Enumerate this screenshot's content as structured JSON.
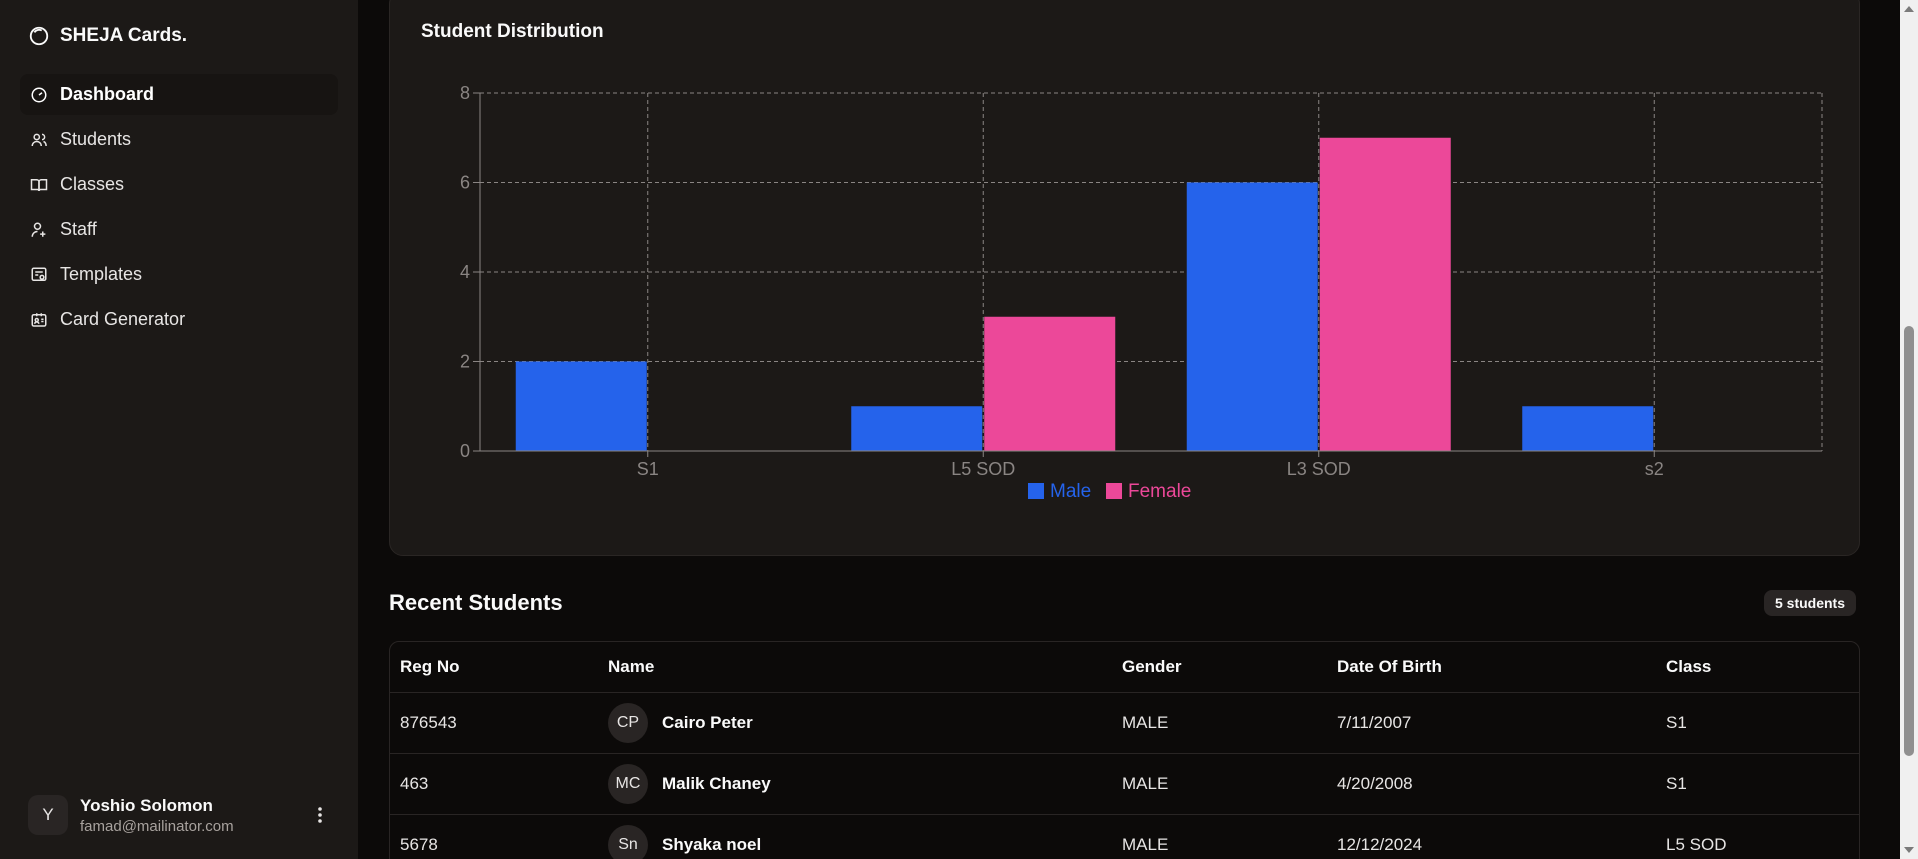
{
  "brand": {
    "name": "SHEJA Cards.",
    "icon": "circle-logo-icon"
  },
  "sidebar": {
    "items": [
      {
        "label": "Dashboard",
        "icon": "gauge-icon",
        "active": true
      },
      {
        "label": "Students",
        "icon": "users-icon",
        "active": false
      },
      {
        "label": "Classes",
        "icon": "book-open-icon",
        "active": false
      },
      {
        "label": "Staff",
        "icon": "user-plus-icon",
        "active": false
      },
      {
        "label": "Templates",
        "icon": "template-icon",
        "active": false
      },
      {
        "label": "Card Generator",
        "icon": "id-card-icon",
        "active": false
      }
    ]
  },
  "user": {
    "initial": "Y",
    "name": "Yoshio Solomon",
    "email": "famad@mailinator.com"
  },
  "distribution": {
    "title": "Student Distribution"
  },
  "chart_data": {
    "type": "bar",
    "title": "Student Distribution",
    "categories": [
      "S1",
      "L5 SOD",
      "L3 SOD",
      "s2"
    ],
    "series": [
      {
        "name": "Male",
        "values": [
          2,
          1,
          6,
          1
        ],
        "color": "#2563eb"
      },
      {
        "name": "Female",
        "values": [
          0,
          3,
          7,
          0
        ],
        "color": "#ec4899"
      }
    ],
    "ylim": [
      0,
      8
    ],
    "yticks": [
      0,
      2,
      4,
      6,
      8
    ],
    "grid": true,
    "legend": "bottom"
  },
  "recent": {
    "title": "Recent Students",
    "badge": "5 students",
    "columns": [
      "Reg No",
      "Name",
      "Gender",
      "Date Of Birth",
      "Class"
    ],
    "rows": [
      {
        "reg": "876543",
        "initials": "CP",
        "name": "Cairo Peter",
        "gender": "MALE",
        "dob": "7/11/2007",
        "class": "S1"
      },
      {
        "reg": "463",
        "initials": "MC",
        "name": "Malik Chaney",
        "gender": "MALE",
        "dob": "4/20/2008",
        "class": "S1"
      },
      {
        "reg": "5678",
        "initials": "Sn",
        "name": "Shyaka noel",
        "gender": "MALE",
        "dob": "12/12/2024",
        "class": "L5 SOD"
      }
    ]
  }
}
